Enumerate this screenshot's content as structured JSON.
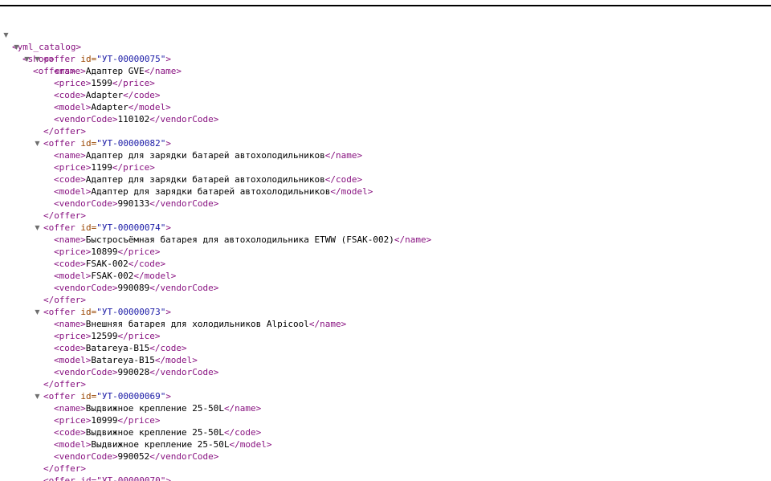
{
  "tags": {
    "root_open": "<yml_catalog>",
    "shop_open": "<shop>",
    "offers_open": "<offers>",
    "offer_open_prefix": "<offer",
    "offer_attr_name": "id",
    "offer_open_suffix": ">",
    "offer_close": "</offer>",
    "name_open": "<name>",
    "name_close": "</name>",
    "price_open": "<price>",
    "price_close": "</price>",
    "code_open": "<code>",
    "code_close": "</code>",
    "model_open": "<model>",
    "model_close": "</model>",
    "vendorCode_open": "<vendorCode>",
    "vendorCode_close": "</vendorCode>"
  },
  "offers": [
    {
      "id": "\"УТ-00000075\"",
      "name": "Адаптер GVE",
      "price": "1599",
      "code": "Adapter",
      "model": "Adapter",
      "vendorCode": "110102"
    },
    {
      "id": "\"УТ-00000082\"",
      "name": "Адаптер для зарядки батарей автохолодильников",
      "price": "1199",
      "code": "Адаптер для зарядки батарей автохолодильников",
      "model": "Адаптер для зарядки батарей автохолодильников",
      "vendorCode": "990133"
    },
    {
      "id": "\"УТ-00000074\"",
      "name": "Быстросъёмная батарея для автохолодильника ETWW (FSAK-002)",
      "price": "10899",
      "code": "FSAK-002",
      "model": "FSAK-002",
      "vendorCode": "990089"
    },
    {
      "id": "\"УТ-00000073\"",
      "name": "Внешняя батарея для холодильников Alpicool",
      "price": "12599",
      "code": "Batareya-B15",
      "model": "Batareya-B15",
      "vendorCode": "990028"
    },
    {
      "id": "\"УТ-00000069\"",
      "name": "Выдвижное крепление 25-50L",
      "price": "10999",
      "code": "Выдвижное крепление 25-50L",
      "model": "Выдвижное крепление 25-50L",
      "vendorCode": "990052"
    }
  ],
  "partial_next_offer": "<offer id=\"УТ-00000070\">",
  "colors": {
    "tag": "#881280",
    "attr_name": "#994500",
    "attr_value": "#1a1aa6",
    "text": "#000000",
    "triangle": "#6e6e6e"
  },
  "icons": {
    "expanded": "triangle-down-icon"
  }
}
